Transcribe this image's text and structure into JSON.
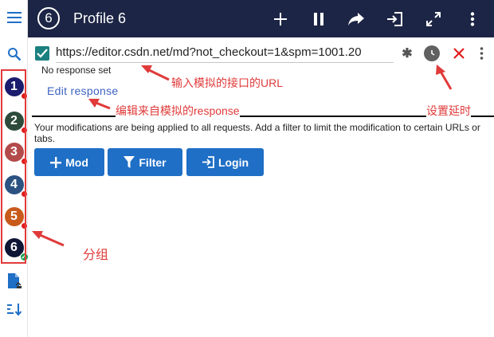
{
  "header": {
    "profile_number": "6",
    "title": "Profile 6"
  },
  "groups": [
    {
      "label": "1",
      "color": "#1c1c6e",
      "status": "red"
    },
    {
      "label": "2",
      "color": "#2d4a3a",
      "status": "red"
    },
    {
      "label": "3",
      "color": "#b34b4b",
      "status": "red"
    },
    {
      "label": "4",
      "color": "#2c5282",
      "status": "red"
    },
    {
      "label": "5",
      "color": "#c85b1c",
      "status": "red"
    },
    {
      "label": "6",
      "color": "#0f1535",
      "status": "green"
    }
  ],
  "request": {
    "enabled": true,
    "url": "https://editor.csdn.net/md?not_checkout=1&spm=1001.20",
    "no_response": "No response set",
    "edit_response": "Edit response"
  },
  "notice": "Your modifications are being applied to all requests. Add a filter to limit the modification to certain URLs or tabs.",
  "buttons": {
    "mod": "Mod",
    "filter": "Filter",
    "login": "Login"
  },
  "annotations": {
    "url": "输入模拟的接口的URL",
    "response": "编辑来自模拟的response",
    "delay": "设置延时",
    "group": "分组"
  },
  "colors": {
    "header_bg": "#1c2545",
    "button_bg": "#1f6fc6",
    "checkbox": "#1b8080",
    "annotation": "#e03a3a"
  }
}
